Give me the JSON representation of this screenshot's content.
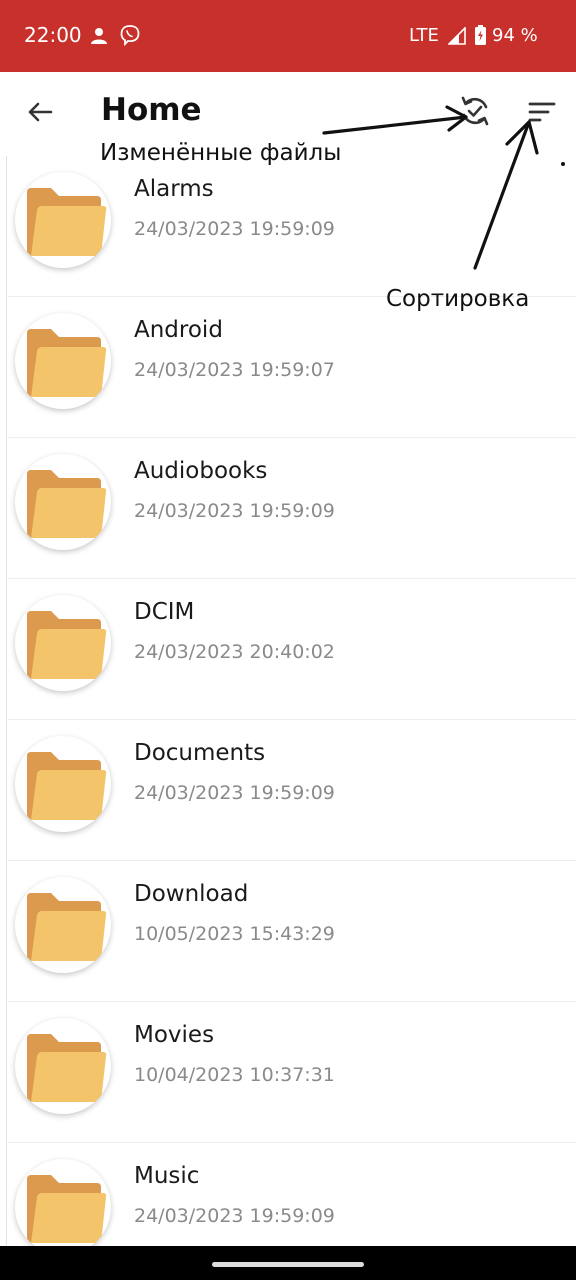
{
  "status_bar": {
    "time": "22:00",
    "network": "LTE",
    "battery": "94 %",
    "icons": [
      "person-icon",
      "viber-icon",
      "signal-icon",
      "battery-charging-icon"
    ],
    "background": "#c8302b"
  },
  "app_bar": {
    "title": "Home",
    "icons": [
      "back-arrow-icon",
      "sync-check-icon",
      "sort-icon"
    ]
  },
  "annotations": {
    "changed_files": "Изменённые файлы",
    "sorting": "Сортировка"
  },
  "folders": [
    {
      "name": "Alarms",
      "modified": "24/03/2023 19:59:09"
    },
    {
      "name": "Android",
      "modified": "24/03/2023 19:59:07"
    },
    {
      "name": "Audiobooks",
      "modified": "24/03/2023 19:59:09"
    },
    {
      "name": "DCIM",
      "modified": "24/03/2023 20:40:02"
    },
    {
      "name": "Documents",
      "modified": "24/03/2023 19:59:09"
    },
    {
      "name": "Download",
      "modified": "10/05/2023 15:43:29"
    },
    {
      "name": "Movies",
      "modified": "10/04/2023 10:37:31"
    },
    {
      "name": "Music",
      "modified": "24/03/2023 19:59:09"
    }
  ],
  "colors": {
    "folder_back": "#dc9a4e",
    "folder_front": "#f3c46a"
  }
}
